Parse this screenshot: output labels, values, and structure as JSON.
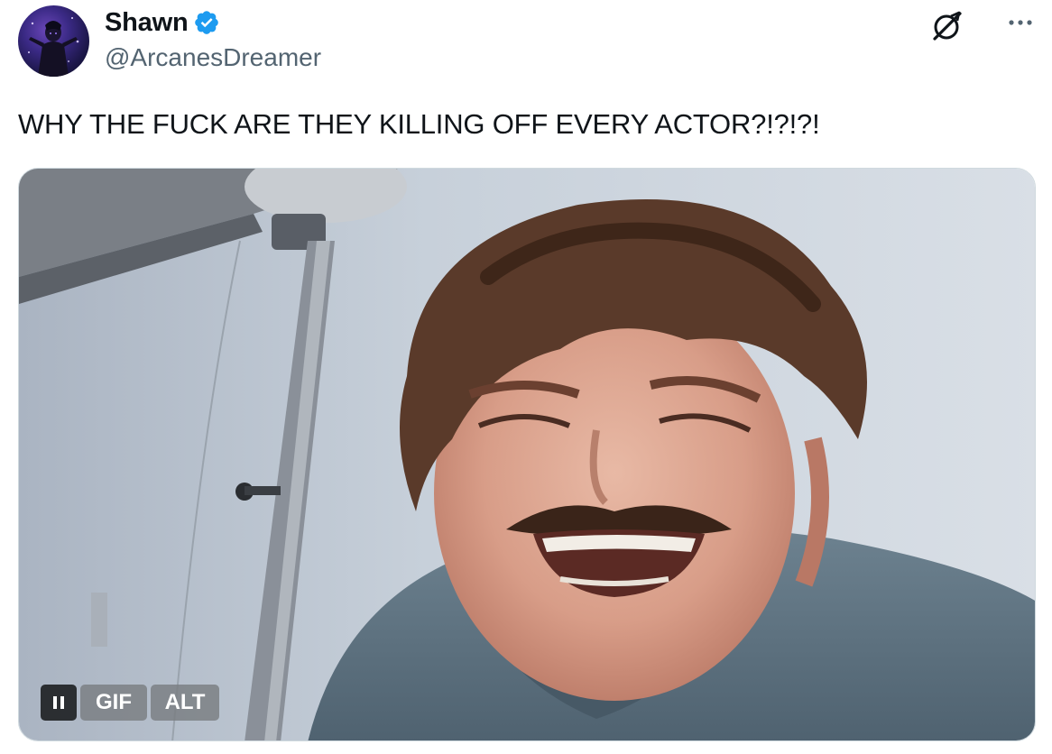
{
  "author": {
    "display_name": "Shawn",
    "handle": "@ArcanesDreamer",
    "verified": true
  },
  "post": {
    "text": "WHY THE FUCK ARE THEY KILLING OFF EVERY ACTOR?!?!?!"
  },
  "media": {
    "type": "gif",
    "controls": {
      "pause_label": "",
      "gif_label": "GIF",
      "alt_label": "ALT"
    }
  },
  "icons": {
    "verified": "verified-badge-icon",
    "grok": "grok-icon",
    "more": "more-options-icon"
  },
  "colors": {
    "text_primary": "#0f1419",
    "text_secondary": "#536471",
    "verified_blue": "#1d9bf0",
    "border": "#cfd9de"
  }
}
